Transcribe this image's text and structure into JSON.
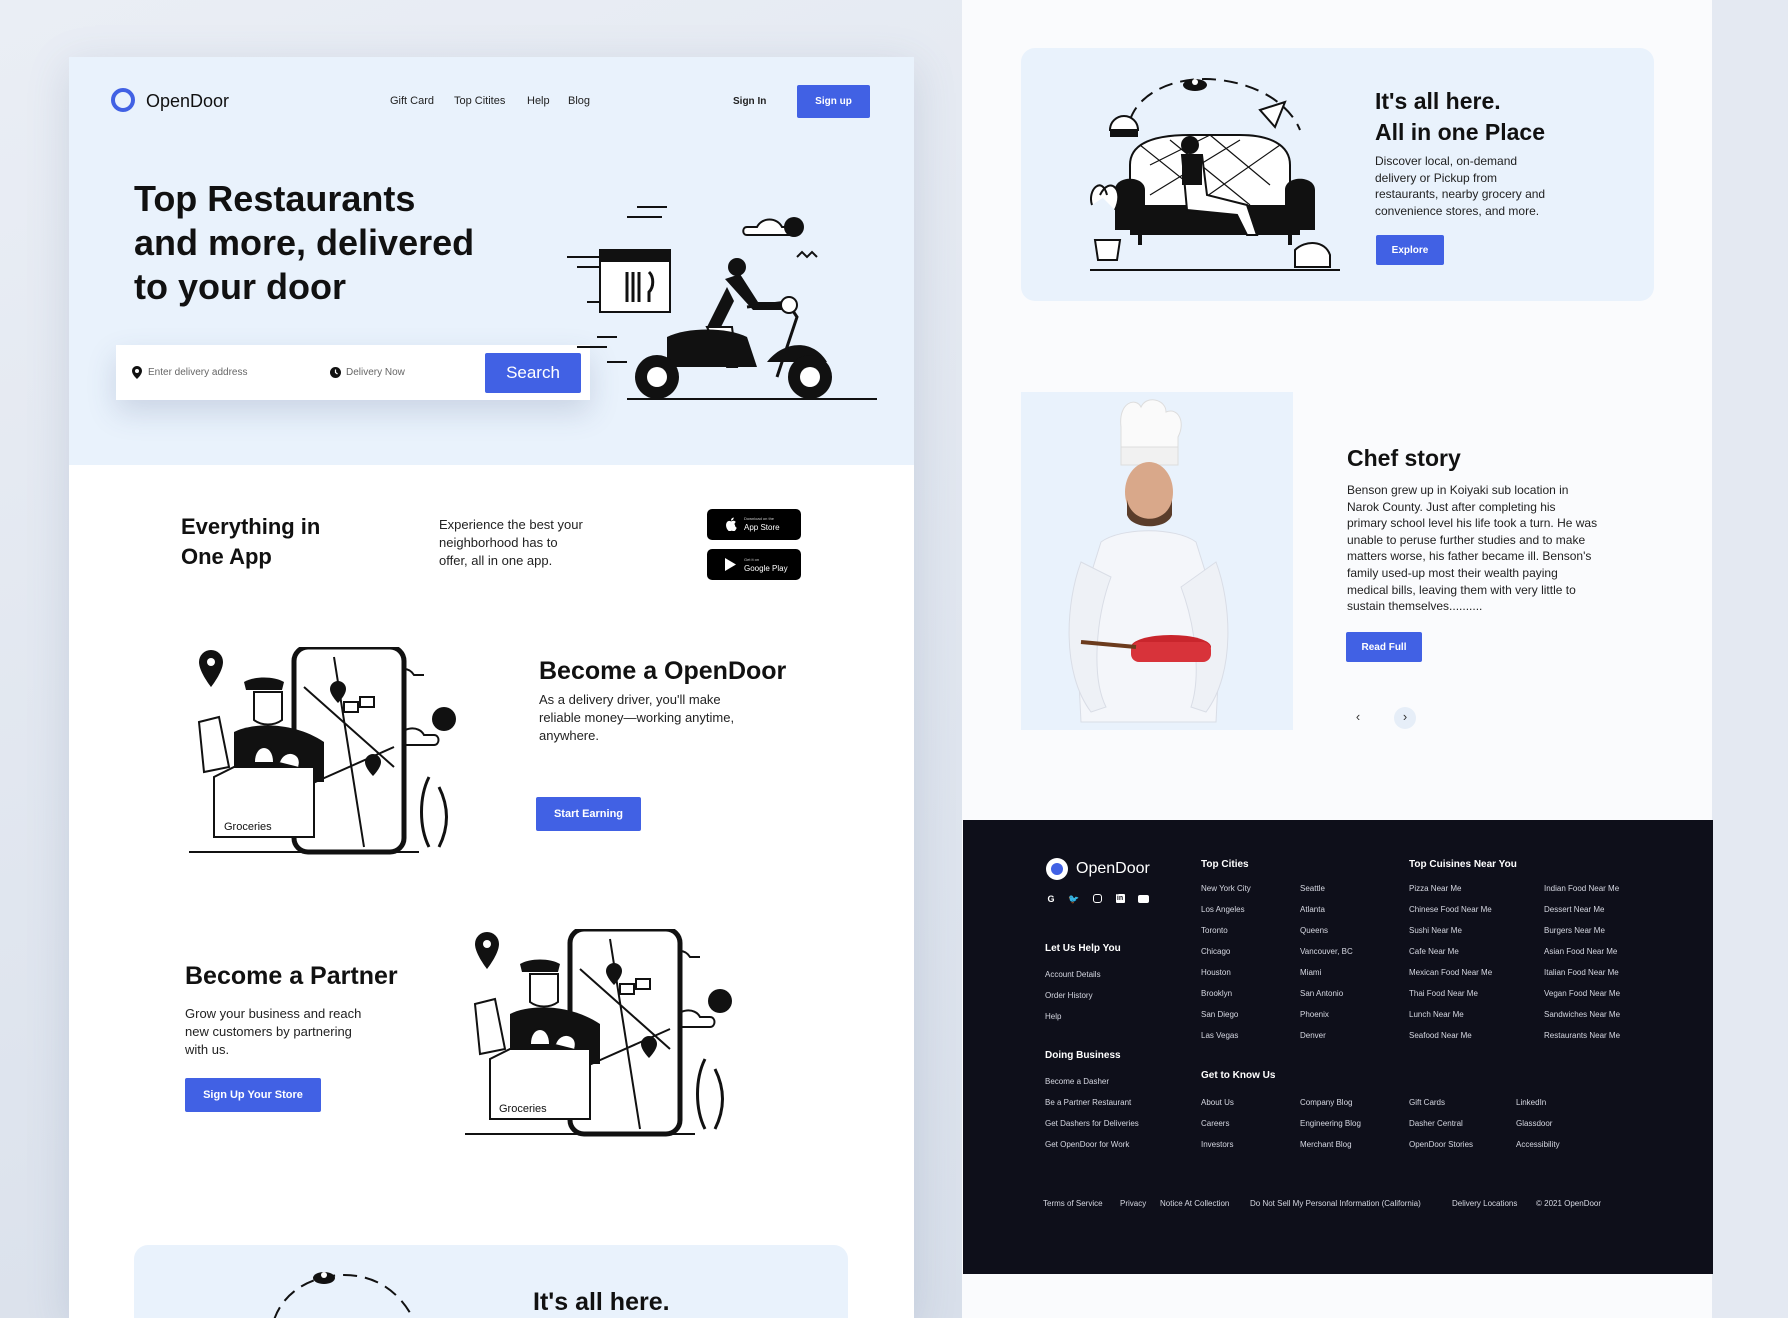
{
  "brand": "OpenDoor",
  "nav": {
    "links": [
      "Gift Card",
      "Top Citites",
      "Help",
      "Blog"
    ],
    "sign_in": "Sign In",
    "sign_up": "Sign up"
  },
  "hero": {
    "title_lines": [
      "Top Restaurants",
      "and more, delivered",
      "to your door"
    ],
    "address_placeholder": "Enter delivery address",
    "time_placeholder": "Delivery Now",
    "search_label": "Search"
  },
  "app_section": {
    "title_lines": [
      "Everything in",
      "One App"
    ],
    "text_lines": [
      "Experience the best your",
      "neighborhood has to",
      "offer, all in one app."
    ],
    "app_store": {
      "small": "Download on the",
      "big": "App Store"
    },
    "google_play": {
      "small": "Get it on",
      "big": "Google Play"
    }
  },
  "driver": {
    "title": "Become a OpenDoor",
    "text_lines": [
      "As a delivery driver, you'll make",
      "reliable money—working anytime,",
      "anywhere."
    ],
    "button": "Start Earning",
    "box_label": "Groceries"
  },
  "partner": {
    "title": "Become a Partner",
    "text_lines": [
      "Grow your business and reach",
      "new customers by partnering",
      "with us."
    ],
    "button": "Sign Up Your Store",
    "box_label": "Groceries"
  },
  "bottom_teaser": {
    "title": "It's all here."
  },
  "all_here": {
    "title_lines": [
      "It's all here.",
      "All in one Place"
    ],
    "text_lines": [
      "Discover local, on-demand",
      "delivery or Pickup from",
      "restaurants, nearby grocery and",
      "convenience stores, and more."
    ],
    "button": "Explore"
  },
  "chef": {
    "title": "Chef story",
    "text_lines": [
      "Benson grew up in Koiyaki sub location in",
      "Narok County. Just after completing his",
      "primary school level his life took a turn. He was",
      "unable to peruse further studies and to make",
      "matters worse, his father became ill. Benson's",
      "family used-up most their wealth paying",
      "medical bills, leaving them with very little to",
      "sustain themselves.........."
    ],
    "button": "Read Full",
    "prev": "‹",
    "next": "›"
  },
  "footer": {
    "brand": "OpenDoor",
    "social_icons": [
      "google-icon",
      "twitter-icon",
      "instagram-icon",
      "linkedin-icon",
      "youtube-icon"
    ],
    "help_title": "Let Us Help You",
    "help_links": [
      "Account Details",
      "Order History",
      "Help"
    ],
    "business_title": "Doing Business",
    "business_links": [
      "Become a Dasher",
      "Be a Partner Restaurant",
      "Get Dashers for Deliveries",
      "Get OpenDoor for Work"
    ],
    "cities_title": "Top Cities",
    "cities_col1": [
      "New York City",
      "Los Angeles",
      "Toronto",
      "Chicago",
      "Houston",
      "Brooklyn",
      "San Diego",
      "Las Vegas"
    ],
    "cities_col2": [
      "Seattle",
      "Atlanta",
      "Queens",
      "Vancouver, BC",
      "Miami",
      "San Antonio",
      "Phoenix",
      "Denver"
    ],
    "cuisines_title": "Top Cuisines Near You",
    "cuisines_col1": [
      "Pizza Near Me",
      "Chinese Food Near Me",
      "Sushi Near Me",
      "Cafe Near Me",
      "Mexican Food Near Me",
      "Thai Food Near Me",
      "Lunch Near Me",
      "Seafood Near Me"
    ],
    "cuisines_col2": [
      "Indian Food Near Me",
      "Dessert Near Me",
      "Burgers Near Me",
      "Asian Food Near Me",
      "Italian Food Near Me",
      "Vegan Food Near Me",
      "Sandwiches Near Me",
      "Restaurants Near Me"
    ],
    "know_title": "Get to Know Us",
    "know_col1": [
      "About Us",
      "Careers",
      "Investors"
    ],
    "know_col2": [
      "Company Blog",
      "Engineering Blog",
      "Merchant Blog"
    ],
    "know_col3": [
      "Gift Cards",
      "Dasher Central",
      "OpenDoor Stories"
    ],
    "know_col4": [
      "LinkedIn",
      "Glassdoor",
      "Accessibility"
    ],
    "legal": [
      "Terms of Service",
      "Privacy",
      "Notice At Collection",
      "Do Not Sell My Personal Information (California)",
      "Delivery Locations",
      "© 2021 OpenDoor"
    ]
  },
  "colors": {
    "accent": "#4161e4",
    "hero_bg": "#e9f2fc",
    "footer_bg": "#0e0f1a"
  }
}
